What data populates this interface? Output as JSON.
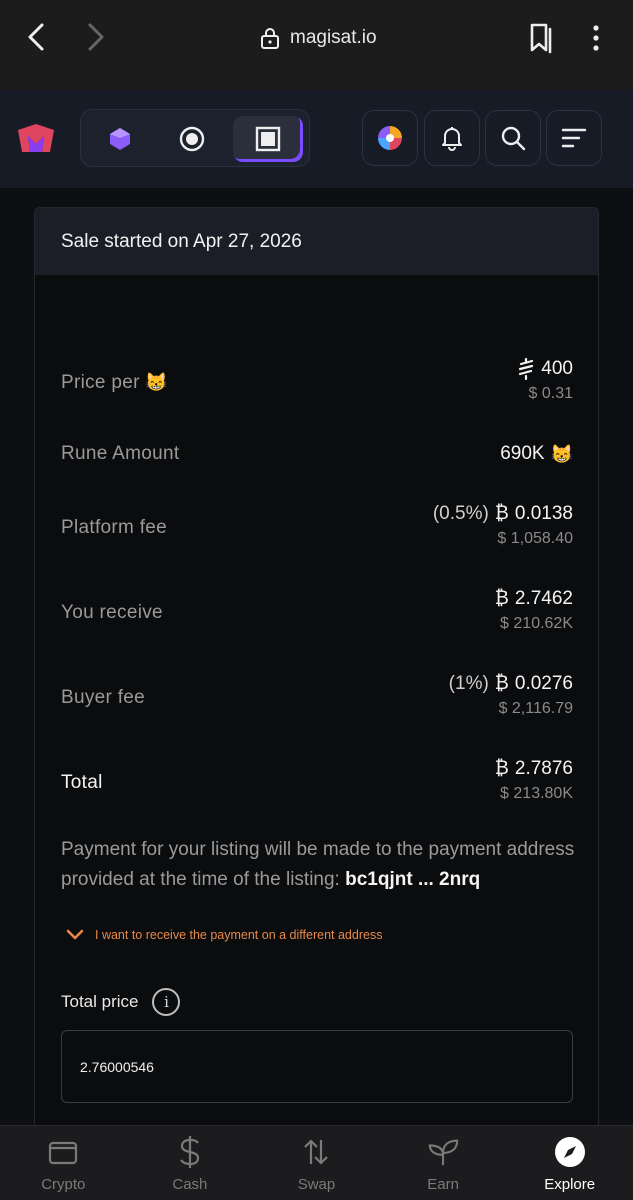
{
  "browser": {
    "url": "magisat.io"
  },
  "header": {
    "segments": [
      "gem-icon",
      "circle-icon",
      "square-icon"
    ],
    "active_segment": 2,
    "buttons": [
      "wheel-icon",
      "bell-icon",
      "search-icon",
      "menu-icon"
    ]
  },
  "sale": {
    "title": "Sale started on Apr 27, 2026",
    "rows": {
      "price_per": {
        "label": "Price per",
        "emoji": "😸",
        "main": "400",
        "main_icon": "sats-icon",
        "sub": "$ 0.31"
      },
      "rune_amount": {
        "label": "Rune Amount",
        "main": "690K",
        "emoji": "😸"
      },
      "platform_fee": {
        "label": "Platform fee",
        "pct": "(0.5%)",
        "main": "0.0138",
        "sub": "$ 1,058.40"
      },
      "you_receive": {
        "label": "You receive",
        "main": "2.7462",
        "sub": "$ 210.62K"
      },
      "buyer_fee": {
        "label": "Buyer fee",
        "pct": "(1%)",
        "main": "0.0276",
        "sub": "$ 2,116.79"
      },
      "total": {
        "label": "Total",
        "main": "2.7876",
        "sub": "$ 213.80K"
      }
    },
    "btc_symbol": "₿",
    "payment_text": "Payment for your listing will be made to the payment address provided at the time of the listing: ",
    "payment_address": "bc1qjnt ... 2nrq",
    "different_address_link": "I want to receive the payment on a different address",
    "total_price_label": "Total price",
    "total_price_value": "2.76000546"
  },
  "bottom_nav": [
    {
      "label": "Crypto",
      "icon": "wallet-icon"
    },
    {
      "label": "Cash",
      "icon": "dollar-icon"
    },
    {
      "label": "Swap",
      "icon": "swap-icon"
    },
    {
      "label": "Earn",
      "icon": "leaf-icon"
    },
    {
      "label": "Explore",
      "icon": "compass-icon",
      "active": true
    }
  ],
  "colors": {
    "accent": "#7a4cff",
    "link": "#e8894a",
    "header_bg": "#161b26"
  }
}
